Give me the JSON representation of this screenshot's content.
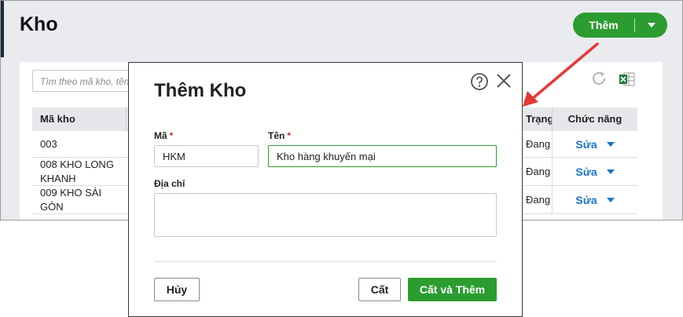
{
  "page": {
    "title": "Kho",
    "add_button_label": "Thêm",
    "search_placeholder": "Tìm theo mã kho, tên"
  },
  "table": {
    "headers": {
      "code": "Mã kho",
      "status": "Trạng",
      "actions": "Chức năng"
    },
    "rows": [
      {
        "code": "003",
        "status": "Đang",
        "action": "Sửa"
      },
      {
        "code": "008 KHO LONG KHANH",
        "status": "Đang",
        "action": "Sửa"
      },
      {
        "code": "009 KHO SÀI GÒN",
        "status": "Đang",
        "action": "Sửa"
      }
    ]
  },
  "modal": {
    "title": "Thêm Kho",
    "code_label": "Mã",
    "name_label": "Tên",
    "required_mark": "*",
    "code_value": "HKM",
    "name_value": "Kho hàng khuyến mại",
    "address_label": "Địa chỉ",
    "address_value": "",
    "cancel_label": "Hủy",
    "save_label": "Cất",
    "save_add_label": "Cất và Thêm"
  },
  "colors": {
    "primary_green": "#2b9c2f",
    "link_blue": "#1a73c9",
    "required_red": "#d02b2b",
    "annotation_red": "#e53935"
  },
  "icons": [
    "caret-down-icon",
    "refresh-icon",
    "excel-icon",
    "help-icon",
    "close-icon"
  ]
}
